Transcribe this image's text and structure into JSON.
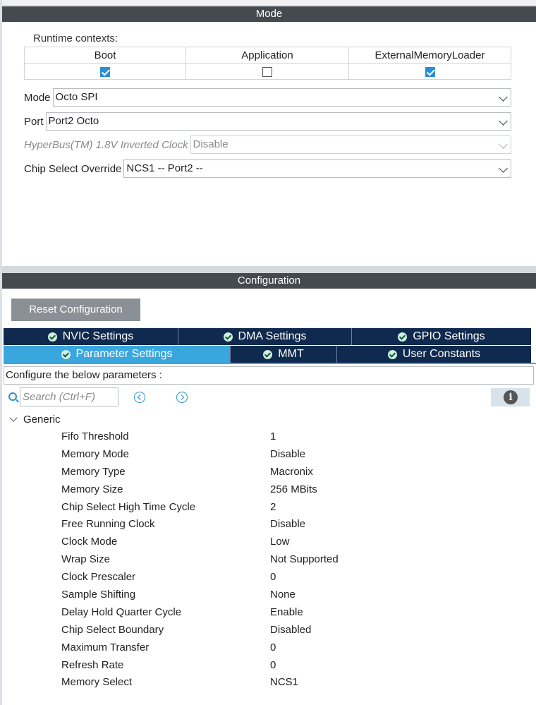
{
  "mode_section": {
    "title": "Mode",
    "runtime_label": "Runtime contexts:",
    "contexts": [
      {
        "label": "Boot",
        "checked": true
      },
      {
        "label": "Application",
        "checked": false
      },
      {
        "label": "ExternalMemoryLoader",
        "checked": true
      }
    ],
    "fields": [
      {
        "label": "Mode",
        "value": "Octo SPI",
        "disabled": false
      },
      {
        "label": "Port",
        "value": "Port2 Octo",
        "disabled": false
      },
      {
        "label": "HyperBus(TM) 1.8V Inverted Clock",
        "value": "Disable",
        "disabled": true
      },
      {
        "label": "Chip Select Override",
        "value": "NCS1 -- Port2 --",
        "disabled": false
      }
    ]
  },
  "config_section": {
    "title": "Configuration",
    "reset_label": "Reset Configuration",
    "tabs_row1": [
      {
        "label": "NVIC Settings",
        "active": false
      },
      {
        "label": "DMA Settings",
        "active": false
      },
      {
        "label": "GPIO Settings",
        "active": false
      }
    ],
    "tabs_row2": [
      {
        "label": "Parameter Settings",
        "active": true
      },
      {
        "label": "MMT",
        "active": false
      },
      {
        "label": "User Constants",
        "active": false
      }
    ],
    "configure_text": "Configure the below parameters :",
    "search_placeholder": "Search (Ctrl+F)",
    "group_label": "Generic",
    "parameters": [
      {
        "name": "Fifo Threshold",
        "value": "1"
      },
      {
        "name": "Memory Mode",
        "value": "Disable"
      },
      {
        "name": "Memory Type",
        "value": "Macronix"
      },
      {
        "name": "Memory Size",
        "value": "256 MBits"
      },
      {
        "name": "Chip Select High Time Cycle",
        "value": "2"
      },
      {
        "name": "Free Running Clock",
        "value": "Disable"
      },
      {
        "name": "Clock Mode",
        "value": "Low"
      },
      {
        "name": "Wrap Size",
        "value": "Not Supported"
      },
      {
        "name": "Clock Prescaler",
        "value": "0"
      },
      {
        "name": "Sample Shifting",
        "value": "None"
      },
      {
        "name": "Delay Hold Quarter Cycle",
        "value": "Enable"
      },
      {
        "name": "Chip Select Boundary",
        "value": "Disabled"
      },
      {
        "name": "Maximum Transfer",
        "value": "0"
      },
      {
        "name": "Refresh Rate",
        "value": "0"
      },
      {
        "name": "Memory Select",
        "value": "NCS1"
      }
    ]
  },
  "colors": {
    "section_bar": "#444a50",
    "tab_dark": "#10294e",
    "tab_active": "#3aa6de",
    "check_blue": "#2a8fd6"
  }
}
